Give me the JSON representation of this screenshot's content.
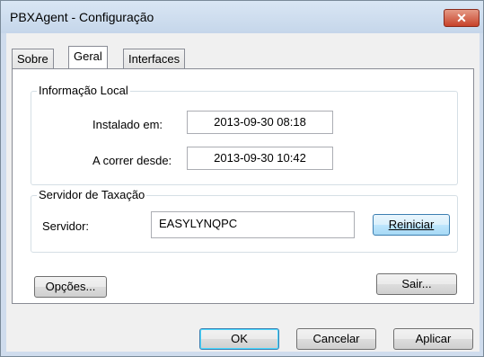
{
  "window": {
    "title": "PBXAgent - Configuração",
    "close_glyph": "✕"
  },
  "tabs": [
    {
      "label": "Sobre",
      "active": false
    },
    {
      "label": "Geral",
      "active": true
    },
    {
      "label": "Interfaces",
      "active": false
    }
  ],
  "local_info": {
    "group_label": "Informação Local",
    "installed_label": "Instalado em:",
    "installed_value": "2013-09-30  08:18",
    "running_label": "A correr desde:",
    "running_value": "2013-09-30  10:42"
  },
  "server": {
    "group_label": "Servidor de Taxação",
    "server_label": "Servidor:",
    "server_value": "EASYLYNQPC",
    "restart_label": "Reiniciar"
  },
  "panel_buttons": {
    "options_label": "Opções...",
    "exit_label": "Sair..."
  },
  "footer": {
    "ok_label": "OK",
    "cancel_label": "Cancelar",
    "apply_label": "Aplicar"
  },
  "colors": {
    "title_bar": "#cfdced",
    "close_button": "#c7422a",
    "focus_border": "#3c7fb1"
  }
}
